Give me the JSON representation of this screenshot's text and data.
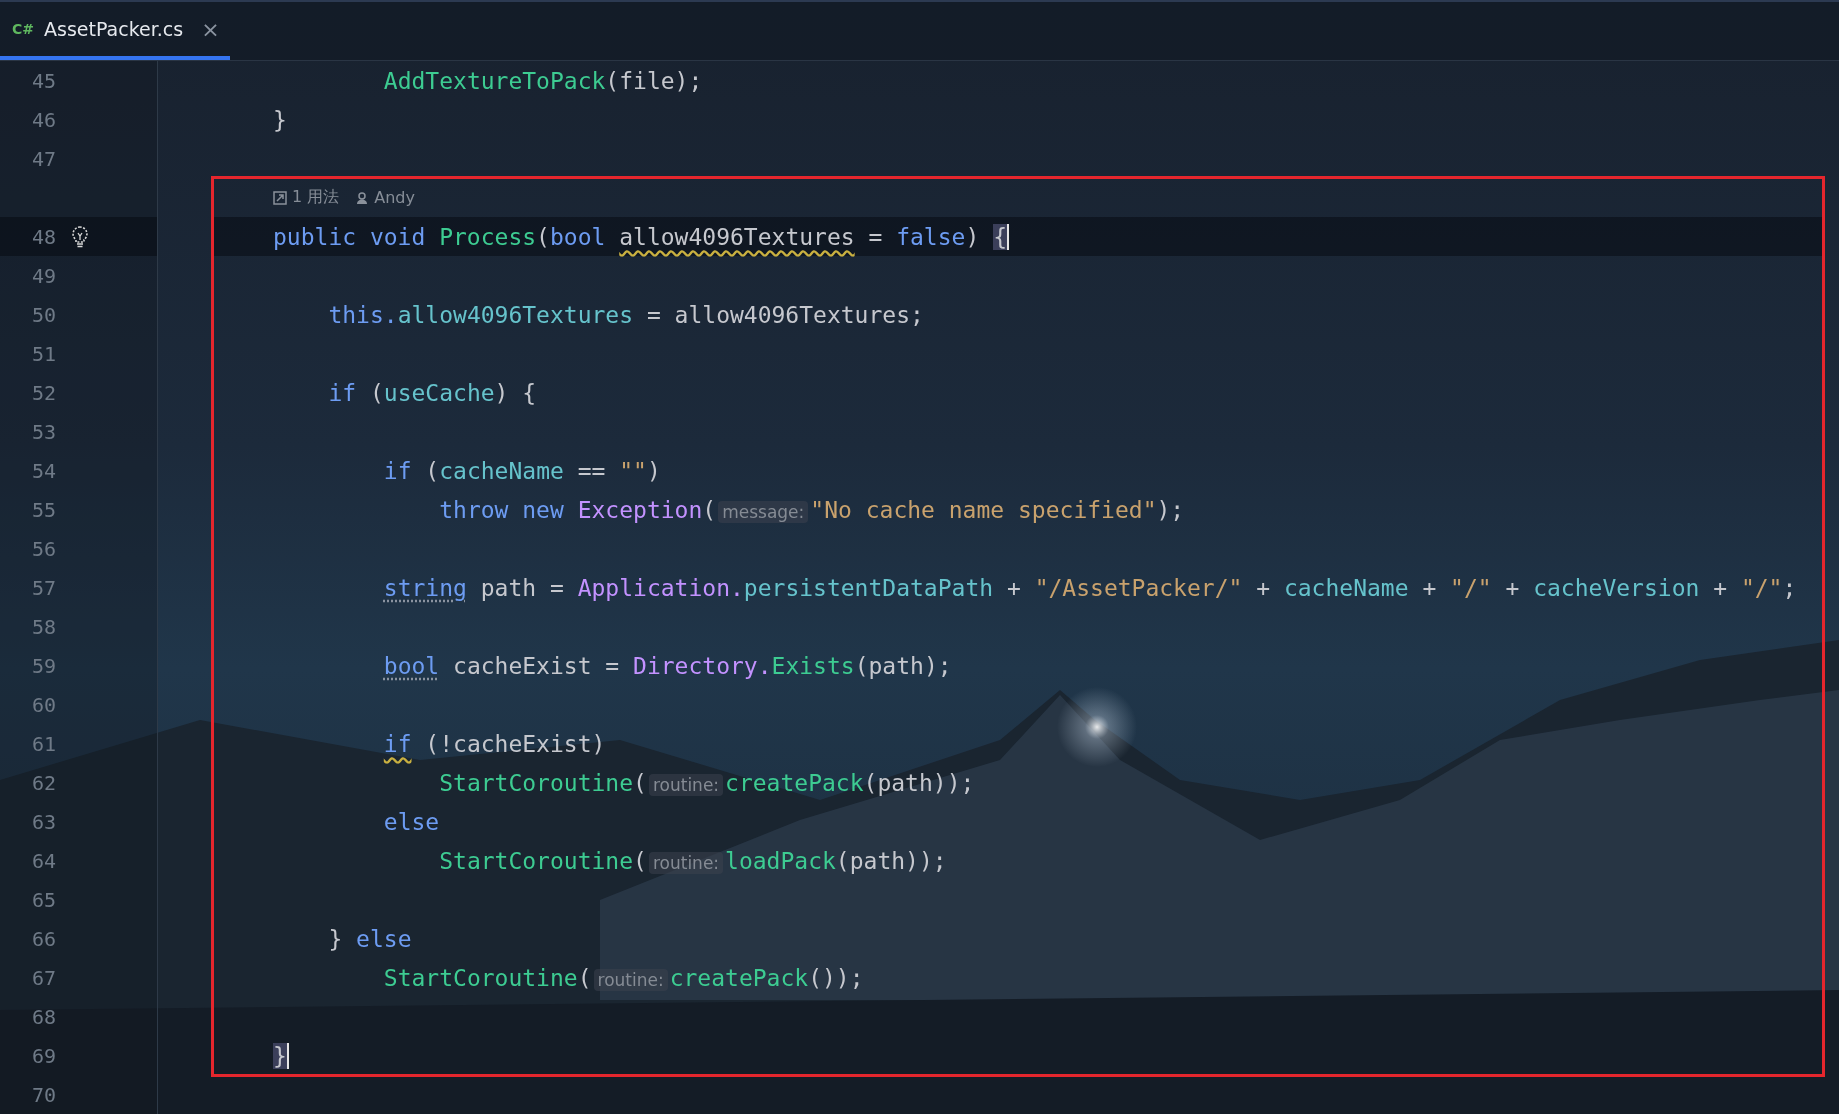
{
  "tab": {
    "lang": "C#",
    "title": "AssetPacker.cs",
    "close": "×",
    "selected": true
  },
  "before": [
    {
      "children": [
        {
          "children": [
            {
              "kind": "code",
              "number": "45",
              "tokens": [
                {
                  "kind": "fn",
                  "text": "AddTextureToPack"
                },
                {
                  "kind": "plain",
                  "text": "(file);"
                }
              ]
            }
          ]
        }
      ]
    },
    {
      "kind": "code",
      "number": "46",
      "tokens": [
        {
          "kind": "plain",
          "text": "}"
        }
      ]
    },
    {
      "kind": "code",
      "number": "47"
    }
  ],
  "highlighted_block": [
    {
      "kind": "inlay",
      "usages": "1 用法",
      "author": "Andy"
    },
    {
      "kind": "code",
      "number": "48",
      "current": true,
      "intention": true,
      "tokens": [
        {
          "kind": "kw",
          "text": "public void "
        },
        {
          "kind": "fn",
          "text": "Process"
        },
        {
          "kind": "plain",
          "text": "("
        },
        {
          "kind": "kw",
          "text": "bool "
        },
        {
          "kind": "plain",
          "text": "allow4096Textures",
          "squiggly": true
        },
        {
          "kind": "plain",
          "text": " = "
        },
        {
          "kind": "kw",
          "text": "false"
        },
        {
          "kind": "plain",
          "text": ") "
        },
        {
          "kind": "plain",
          "text": "{",
          "matched": true
        }
      ],
      "children": [
        {
          "kind": "code",
          "number": "49"
        },
        {
          "kind": "code",
          "number": "50",
          "tokens": [
            {
              "kind": "kw",
              "text": "this."
            },
            {
              "kind": "field",
              "text": "allow4096Textures"
            },
            {
              "kind": "plain",
              "text": " = allow4096Textures;"
            }
          ]
        },
        {
          "kind": "code",
          "number": "51"
        },
        {
          "kind": "code",
          "number": "52",
          "tokens": [
            {
              "kind": "kw",
              "text": "if"
            },
            {
              "kind": "plain",
              "text": " ("
            },
            {
              "kind": "field",
              "text": "useCache"
            },
            {
              "kind": "plain",
              "text": ") {"
            }
          ],
          "children": [
            {
              "kind": "code",
              "number": "53"
            },
            {
              "kind": "code",
              "number": "54",
              "tokens": [
                {
                  "kind": "kw",
                  "text": "if"
                },
                {
                  "kind": "plain",
                  "text": " ("
                },
                {
                  "kind": "field",
                  "text": "cacheName"
                },
                {
                  "kind": "plain",
                  "text": " == "
                },
                {
                  "kind": "str",
                  "text": "\"\""
                },
                {
                  "kind": "plain",
                  "text": ")"
                }
              ],
              "children": [
                {
                  "kind": "code",
                  "number": "55",
                  "tokens": [
                    {
                      "kind": "kw",
                      "text": "throw new "
                    },
                    {
                      "kind": "type",
                      "text": "Exception"
                    },
                    {
                      "kind": "plain",
                      "text": "("
                    },
                    {
                      "kind": "hint",
                      "text": "message:"
                    },
                    {
                      "kind": "str",
                      "text": "\"No cache name specified\""
                    },
                    {
                      "kind": "plain",
                      "text": ");"
                    }
                  ]
                }
              ]
            },
            {
              "kind": "code",
              "number": "56"
            },
            {
              "kind": "code",
              "number": "57",
              "tokens": [
                {
                  "kind": "kw",
                  "text": "string",
                  "dotted": true
                },
                {
                  "kind": "plain",
                  "text": " path = "
                },
                {
                  "kind": "type",
                  "text": "Application."
                },
                {
                  "kind": "field",
                  "text": "persistentDataPath"
                },
                {
                  "kind": "plain",
                  "text": " + "
                },
                {
                  "kind": "str",
                  "text": "\"/AssetPacker/\""
                },
                {
                  "kind": "plain",
                  "text": " + "
                },
                {
                  "kind": "field",
                  "text": "cacheName"
                },
                {
                  "kind": "plain",
                  "text": " + "
                },
                {
                  "kind": "str",
                  "text": "\"/\""
                },
                {
                  "kind": "plain",
                  "text": " + "
                },
                {
                  "kind": "field",
                  "text": "cacheVersion"
                },
                {
                  "kind": "plain",
                  "text": " + "
                },
                {
                  "kind": "str",
                  "text": "\"/\""
                },
                {
                  "kind": "plain",
                  "text": ";"
                }
              ]
            },
            {
              "kind": "code",
              "number": "58"
            },
            {
              "kind": "code",
              "number": "59",
              "tokens": [
                {
                  "kind": "kw",
                  "text": "bool",
                  "dotted": true
                },
                {
                  "kind": "plain",
                  "text": " cacheExist = "
                },
                {
                  "kind": "type",
                  "text": "Directory."
                },
                {
                  "kind": "fn",
                  "text": "Exists"
                },
                {
                  "kind": "plain",
                  "text": "(path);"
                }
              ]
            },
            {
              "kind": "code",
              "number": "60"
            },
            {
              "kind": "code",
              "number": "61",
              "tokens": [
                {
                  "kind": "kw",
                  "text": "if",
                  "squiggly": true
                },
                {
                  "kind": "plain",
                  "text": " (!cacheExist)"
                }
              ],
              "children": [
                {
                  "kind": "code",
                  "number": "62",
                  "tokens": [
                    {
                      "kind": "fn",
                      "text": "StartCoroutine"
                    },
                    {
                      "kind": "plain",
                      "text": "("
                    },
                    {
                      "kind": "hint",
                      "text": "routine:"
                    },
                    {
                      "kind": "fn",
                      "text": "createPack"
                    },
                    {
                      "kind": "plain",
                      "text": "(path));"
                    }
                  ]
                }
              ]
            },
            {
              "kind": "code",
              "number": "63",
              "tokens": [
                {
                  "kind": "kw",
                  "text": "else"
                }
              ],
              "children": [
                {
                  "kind": "code",
                  "number": "64",
                  "tokens": [
                    {
                      "kind": "fn",
                      "text": "StartCoroutine"
                    },
                    {
                      "kind": "plain",
                      "text": "("
                    },
                    {
                      "kind": "hint",
                      "text": "routine:"
                    },
                    {
                      "kind": "fn",
                      "text": "loadPack"
                    },
                    {
                      "kind": "plain",
                      "text": "(path));"
                    }
                  ]
                }
              ]
            },
            {
              "kind": "code",
              "number": "65"
            }
          ]
        },
        {
          "kind": "code",
          "number": "66",
          "tokens": [
            {
              "kind": "plain",
              "text": "} "
            },
            {
              "kind": "kw",
              "text": "else"
            }
          ],
          "children": [
            {
              "kind": "code",
              "number": "67",
              "tokens": [
                {
                  "kind": "fn",
                  "text": "StartCoroutine"
                },
                {
                  "kind": "plain",
                  "text": "("
                },
                {
                  "kind": "hint",
                  "text": "routine:"
                },
                {
                  "kind": "fn",
                  "text": "createPack"
                },
                {
                  "kind": "plain",
                  "text": "());"
                }
              ]
            }
          ]
        },
        {
          "kind": "code",
          "number": "68"
        }
      ]
    },
    {
      "kind": "code",
      "number": "69",
      "tokens": [
        {
          "kind": "plain",
          "text": "}",
          "matched": true
        }
      ]
    }
  ],
  "after": [
    {
      "kind": "code",
      "number": "70"
    }
  ]
}
